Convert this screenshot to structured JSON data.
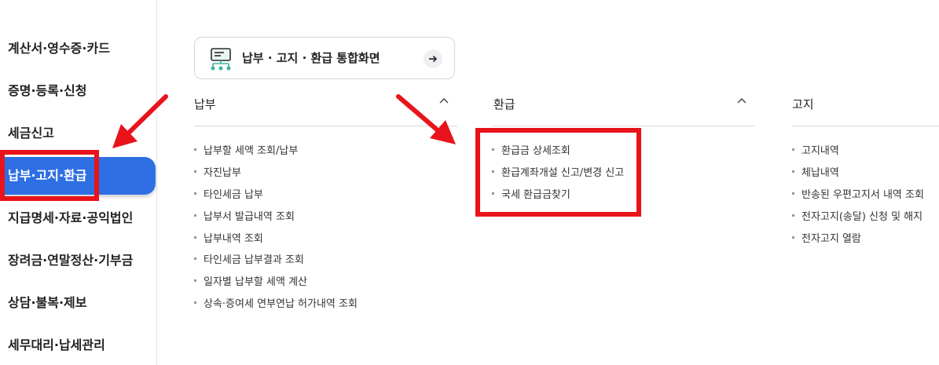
{
  "sidebar": {
    "items": [
      {
        "label": "계산서·영수증·카드"
      },
      {
        "label": "증명·등록·신청"
      },
      {
        "label": "세금신고"
      },
      {
        "label": "납부·고지·환급",
        "active": true
      },
      {
        "label": "지급명세·자료·공익법인"
      },
      {
        "label": "장려금·연말정산·기부금"
      },
      {
        "label": "상담·불복·제보"
      },
      {
        "label": "세무대리·납세관리"
      }
    ]
  },
  "top_card": {
    "label": "납부 · 고지 · 환급 통합화면",
    "icon": "network-screen-icon",
    "arrow_icon": "arrow-right-icon"
  },
  "columns": [
    {
      "title": "납부",
      "toggle": "^",
      "links": [
        "납부할 세액 조회/납부",
        "자진납부",
        "타인세금 납부",
        "납부서 발급내역 조회",
        "납부내역 조회",
        "타인세금 납부결과 조회",
        "일자별 납부할 세액 계산",
        "상속·증여세 연부연납 허가내역 조회"
      ]
    },
    {
      "title": "환급",
      "toggle": "^",
      "links": [
        "환급금 상세조회",
        "환급계좌개설 신고/변경 신고",
        "국세 환급금찾기"
      ]
    },
    {
      "title": "고지",
      "toggle": "",
      "links": [
        "고지내역",
        "체납내역",
        "반송된 우편고지서 내역 조회",
        "전자고지(송달) 신청 및 해지",
        "전자고지 열람"
      ]
    }
  ],
  "colors": {
    "active_bg": "#2f6fe4",
    "annotation": "#e8131b"
  }
}
